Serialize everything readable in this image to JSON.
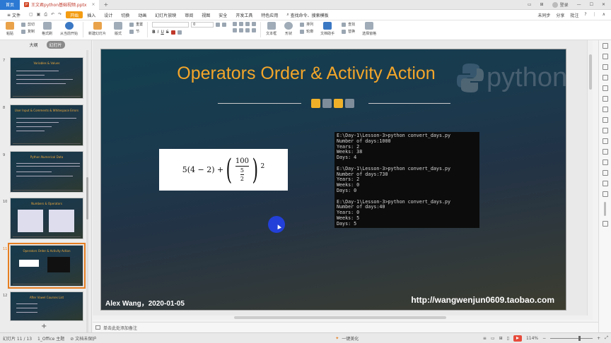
{
  "titlebar": {
    "home_tab": "首页",
    "doc_tab": "王文君python基础视频.pptx",
    "add_tab": "+",
    "login": "登录"
  },
  "menubar": {
    "file": "文件",
    "items": [
      "开始",
      "插入",
      "设计",
      "切换",
      "动画",
      "幻灯片放映",
      "审阅",
      "视图",
      "安全",
      "开发工具",
      "特色应用"
    ],
    "search": "查找命令、搜索模板",
    "right": [
      "未同步",
      "分享",
      "批注"
    ]
  },
  "ribbon": {
    "paste": "粘贴",
    "cut": "剪切",
    "copy": "复制",
    "format_painter": "格式刷",
    "from_current": "从当前开始",
    "new_slide": "新建幻灯片",
    "layout": "版式",
    "section": "节",
    "reset": "重置",
    "font_size": "0",
    "textbox": "文本框",
    "shape": "形状",
    "arrange": "排列",
    "outline": "轮廓",
    "doc_assist": "文档助手",
    "find": "查找",
    "replace": "替换",
    "select_pane": "选择窗格"
  },
  "leftpanel": {
    "tab_outline": "大纲",
    "tab_slides": "幻灯片",
    "thumbs": [
      {
        "num": "7",
        "title": "Variables & Values"
      },
      {
        "num": "8",
        "title": "User Input & Comments & Whitespace Errors"
      },
      {
        "num": "9",
        "title": "Python Numerical Data"
      },
      {
        "num": "10",
        "title": "Numbers & Operators"
      },
      {
        "num": "11",
        "title": "Operators Order & Activity Action"
      },
      {
        "num": "12",
        "title": "After Vowel Courses List"
      }
    ]
  },
  "slide": {
    "title": "Operators Order & Activity Action",
    "python_word": "python",
    "formula": {
      "a": "5(4 − 2) + ",
      "num": "100",
      "inner_num": "5",
      "inner_den": "2",
      "exp": "2"
    },
    "console_lines": [
      "E:\\Day-1\\Lesson-3>python convert_days.py",
      "Number of days:1000",
      "Years: 2",
      "Weeks: 38",
      "Days: 4",
      "",
      "E:\\Day-1\\Lesson-3>python convert_days.py",
      "Number of days:730",
      "Years: 2",
      "Weeks: 0",
      "Days: 0",
      "",
      "E:\\Day-1\\Lesson-3>python convert_days.py",
      "Number of days:40",
      "Years: 0",
      "Weeks: 5",
      "Days: 5"
    ],
    "author": "Alex Wang，2020-01-05",
    "site": "http://wangwenjun0609.taobao.com"
  },
  "notes": {
    "placeholder": "单击此处添加备注"
  },
  "statusbar": {
    "slide_count": "幻灯片 11 / 13",
    "theme": "1_Office 主题",
    "protect": "文档未保护",
    "beautify": "一键美化",
    "zoom": "114%"
  },
  "colors": {
    "accent": "#f4a62a",
    "home_tab": "#2b79d3",
    "active_menu": "#f39c12"
  }
}
